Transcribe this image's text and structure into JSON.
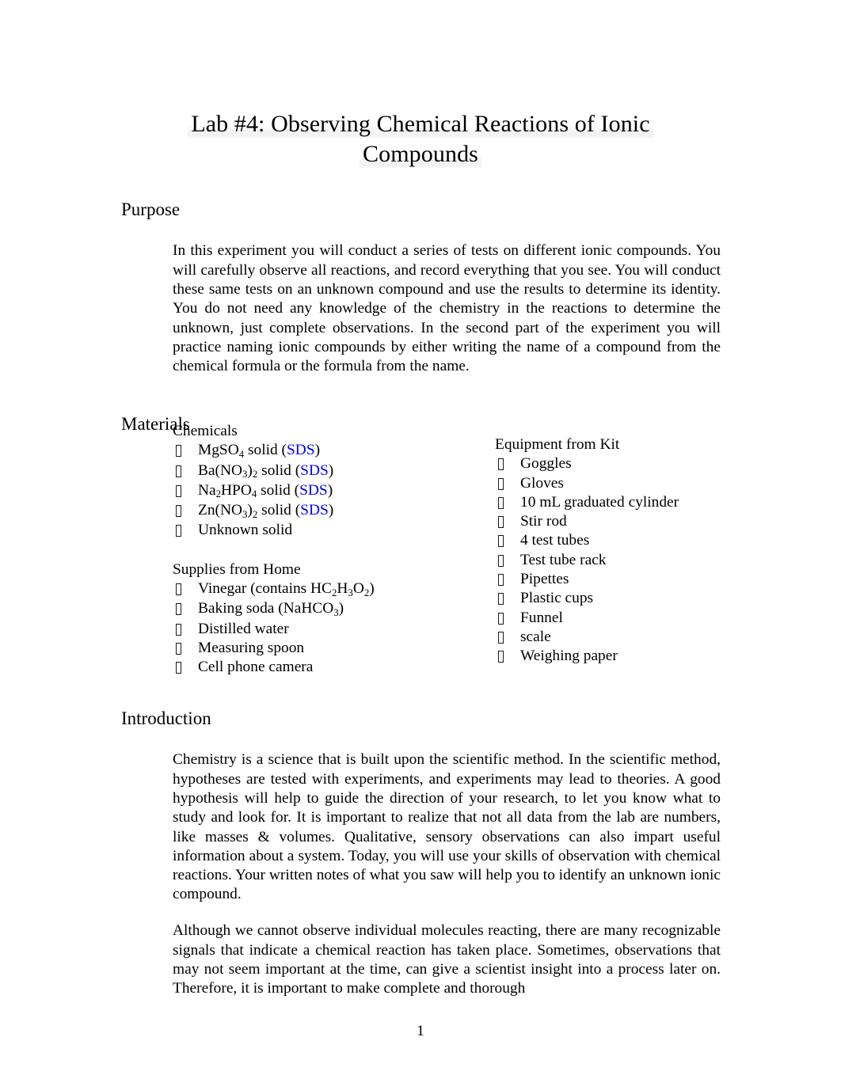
{
  "document": {
    "title_line_1": "Lab #4: Observing Chemical Reactions of Ionic",
    "title_line_2": "Compounds",
    "page_number": "1",
    "link_color": "#0000ff",
    "text_color": "#000000",
    "background_color": "#ffffff"
  },
  "sections": {
    "purpose": {
      "heading": "Purpose",
      "paragraph": "In this experiment you will conduct a series of tests on different ionic compounds. You will carefully observe all reactions, and record everything that you see. You will conduct these same tests on an unknown compound and use the results to determine its identity. You do not need any knowledge of the chemistry in the reactions to determine the unknown, just complete observations. In the second part of the experiment you will practice naming ionic compounds by either writing the name of a compound from the chemical formula or the formula from the name."
    },
    "materials": {
      "heading": "Materials",
      "chemicals": {
        "label": "Chemicals",
        "items": [
          {
            "formula_html": "MgSO<sub>4</sub>",
            "suffix": " solid (",
            "link": "SDS",
            "close": ")"
          },
          {
            "formula_html": "Ba(NO<sub>3</sub>)<sub>2</sub>",
            "suffix": " solid (",
            "link": "SDS",
            "close": ")"
          },
          {
            "formula_html": "Na<sub>2</sub>HPO<sub>4</sub>",
            "suffix": " solid (",
            "link": "SDS",
            "close": ")"
          },
          {
            "formula_html": "Zn(NO<sub>3</sub>)<sub>2</sub>",
            "suffix": " solid (",
            "link": "SDS",
            "close": ")"
          },
          {
            "formula_html": "Unknown solid",
            "suffix": "",
            "link": "",
            "close": ""
          }
        ]
      },
      "supplies_from_home": {
        "label": "Supplies from Home",
        "items": [
          {
            "text_html": "Vinegar (contains HC<sub>2</sub>H<sub>3</sub>O<sub>2</sub>)"
          },
          {
            "text_html": "Baking soda (NaHCO<sub>3</sub>)"
          },
          {
            "text_html": "Distilled water"
          },
          {
            "text_html": "Measuring spoon"
          },
          {
            "text_html": "Cell phone camera"
          }
        ]
      },
      "equipment_from_kit": {
        "label": "Equipment from Kit",
        "items": [
          {
            "text_html": "Goggles"
          },
          {
            "text_html": "Gloves"
          },
          {
            "text_html": "10 mL graduated cylinder"
          },
          {
            "text_html": "Stir rod"
          },
          {
            "text_html": "4 test tubes"
          },
          {
            "text_html": "Test tube rack"
          },
          {
            "text_html": "Pipettes"
          },
          {
            "text_html": "Plastic cups"
          },
          {
            "text_html": "Funnel"
          },
          {
            "text_html": "scale"
          },
          {
            "text_html": "Weighing paper"
          }
        ]
      }
    },
    "introduction": {
      "heading": "Introduction",
      "paragraph_1": "Chemistry is a science that is built upon the scientific method. In the scientific method, hypotheses are tested with experiments, and experiments may lead to theories. A good hypothesis will help to guide the direction of your research, to let you know what to study and look for. It is important to realize that not all data from the lab are numbers, like masses & volumes. Qualitative, sensory observations can also impart useful information about a system. Today, you will use your skills of observation with chemical reactions. Your written notes of what you saw will help you to identify an unknown ionic compound.",
      "paragraph_2": "Although we cannot observe individual molecules reacting, there are many recognizable signals that indicate a chemical reaction has taken place. Sometimes, observations that may not seem important at the time, can give a scientist insight into a process later on. Therefore, it is important to make complete and thorough"
    }
  }
}
